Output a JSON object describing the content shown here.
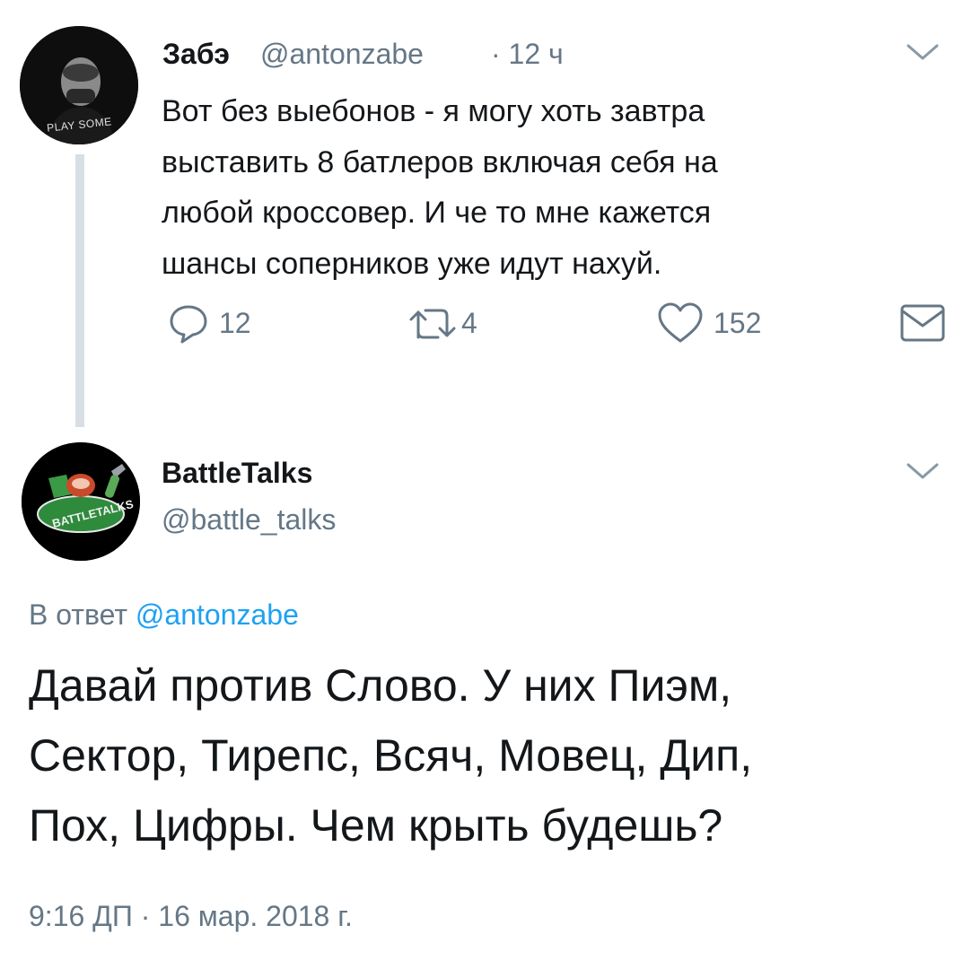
{
  "tweet1": {
    "author": {
      "name": "Забэ",
      "handle": "@antonzabe",
      "avatar_text": "PLAY SOME"
    },
    "time": "· 12 ч",
    "text_lines": [
      "Вот без выебонов - я могу хоть завтра",
      "выставить 8 батлеров включая себя на",
      "любой кроссовер. И че то мне кажется",
      "шансы соперников уже идут нахуй."
    ],
    "actions": {
      "reply": {
        "icon": "reply-icon",
        "count": "12"
      },
      "retweet": {
        "icon": "retweet-icon",
        "count": "4"
      },
      "like": {
        "icon": "heart-icon",
        "count": "152"
      },
      "dm": {
        "icon": "envelope-icon"
      }
    },
    "menu_icon": "chevron-down-icon"
  },
  "tweet2": {
    "author": {
      "name": "BattleTalks",
      "handle": "@battle_talks",
      "avatar_text": "BATTLETALKS"
    },
    "menu_icon": "chevron-down-icon",
    "reply_to_prefix": "В ответ",
    "reply_to_handle": "@antonzabe",
    "text_lines": [
      "Давай против Слово. У них Пиэм,",
      "Сектор, Тирепс, Всяч, Мовец, Дип,",
      "Пох, Цифры. Чем крыть будешь?"
    ],
    "timestamp": "9:16 ДП · 16 мар. 2018 г."
  },
  "colors": {
    "text": "#14171a",
    "secondary": "#657786",
    "link": "#1da1f2",
    "thread_line": "#d8dfe4"
  }
}
